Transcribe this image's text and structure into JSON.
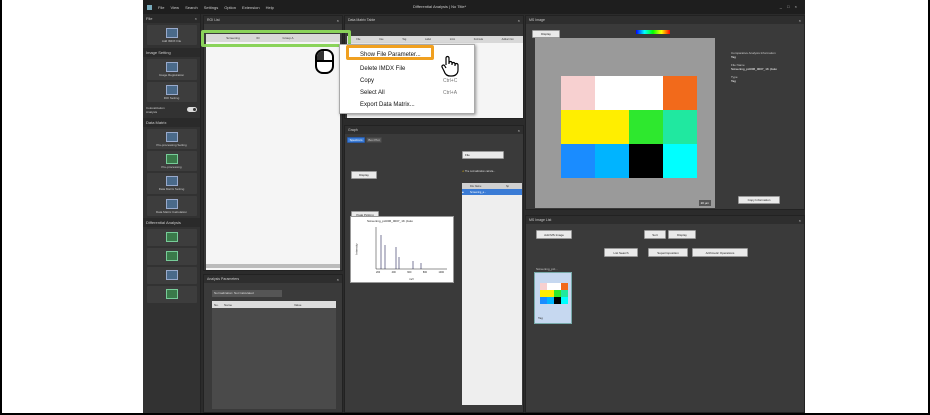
{
  "titlebar": {
    "menus": [
      "File",
      "View",
      "Search",
      "Settings",
      "Option",
      "Extension",
      "Help"
    ],
    "title": "Differential Analysis  |  No Title*",
    "window_controls": "_ □ ×"
  },
  "sidebar": {
    "file_header": "File",
    "image_setting_header": "Image Setting",
    "colocalization_label": "Colocalization Analysis",
    "data_matrix_header": "Data Matrix",
    "differential_header": "Differential Analysis",
    "buttons": [
      "Add IMDX File",
      "Image Registration",
      "ROI Setting",
      "Pre-processing Setting",
      "Pre-processing",
      "Data Matrix Setting",
      "Data Matrix Calculation",
      "",
      "",
      "",
      "",
      ""
    ]
  },
  "roi_list": {
    "title": "ROI List",
    "columns": [
      "",
      "Screening",
      "ID",
      "Group A"
    ]
  },
  "data_matrix_table": {
    "title": "Data Matrix Table",
    "columns": [
      "File",
      "Use",
      "Tag",
      "Label",
      "Ionic",
      "Formula",
      "Adduct Ion"
    ]
  },
  "context_menu": {
    "items": [
      {
        "label": "Show File Parameter...",
        "shortcut": ""
      },
      {
        "label": "Delete IMDX File",
        "shortcut": ""
      },
      {
        "label": "Copy",
        "shortcut": "Ctrl+C"
      },
      {
        "label": "Select All",
        "shortcut": "Ctrl+A"
      },
      {
        "label": "Export Data Matrix...",
        "shortcut": ""
      }
    ]
  },
  "analysis_parameters": {
    "title": "Analysis Parameters",
    "status": "Normalization: Not Calculated",
    "columns": [
      "No.",
      "Name",
      "Value"
    ]
  },
  "graph": {
    "title": "Graph",
    "tabs": [
      "Spectrum",
      "Box Plot"
    ],
    "display_label": "Display",
    "peak_picking": "Peak Picking",
    "file_select": "File",
    "warning": "The normalization calcula...",
    "file_columns": [
      "",
      "File Name",
      "Sp"
    ],
    "file_row": "Screening_a...",
    "chart_title": "Screening_pct006_0007_1K (Auto",
    "ylabel": "Intensity",
    "xlabel": "m/z",
    "xticks": [
      "200",
      "400",
      "600",
      "800",
      "1000"
    ]
  },
  "ms_image": {
    "title": "MS Image",
    "display_label": "Display",
    "colorscale": "75%",
    "side_labels": [
      {
        "label": "Comparative Analysis Information",
        "value": "Tag"
      },
      {
        "label": "File Name",
        "value": "Screening_pct006_0007_1K (Auto"
      },
      {
        "label": "Type",
        "value": "Tag"
      }
    ],
    "copy_info": "Copy Information",
    "scale_tag": "20 µm",
    "swatch_colors": [
      "#f7d0d0",
      "#ffffff",
      "#ffffff",
      "#f26a1b",
      "#ffee00",
      "#ffee00",
      "#2ee82e",
      "#20e8a0",
      "#1a8cff",
      "#00b4ff",
      "#000000",
      "#00ffff"
    ]
  },
  "ms_image_list": {
    "title": "MS Image List",
    "add_button": "Add MS Image",
    "sort": "Sort",
    "display": "Display",
    "list_search": "List Search",
    "superimposition": "Superimposition",
    "arithmetic": "Arithmetic Operations",
    "thumb_label": "Screening_pct...",
    "thumb_tag": "Tag"
  }
}
